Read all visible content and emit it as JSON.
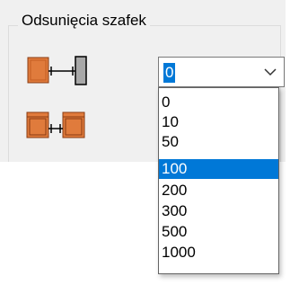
{
  "group": {
    "title": "Odsunięcia szafek"
  },
  "icons": {
    "cabinet_wall_offset": "cabinet-to-wall-offset-icon",
    "cabinet_cabinet_offset": "cabinet-to-cabinet-offset-icon"
  },
  "combo": {
    "value": "0"
  },
  "dropdown": {
    "options": [
      "0",
      "10",
      "50",
      "100",
      "200",
      "300",
      "500",
      "1000"
    ],
    "highlighted": "100"
  },
  "colors": {
    "accent": "#0078d7",
    "cabinet_orange": "#e07b3c",
    "panel_bg": "#f0f0f0"
  }
}
